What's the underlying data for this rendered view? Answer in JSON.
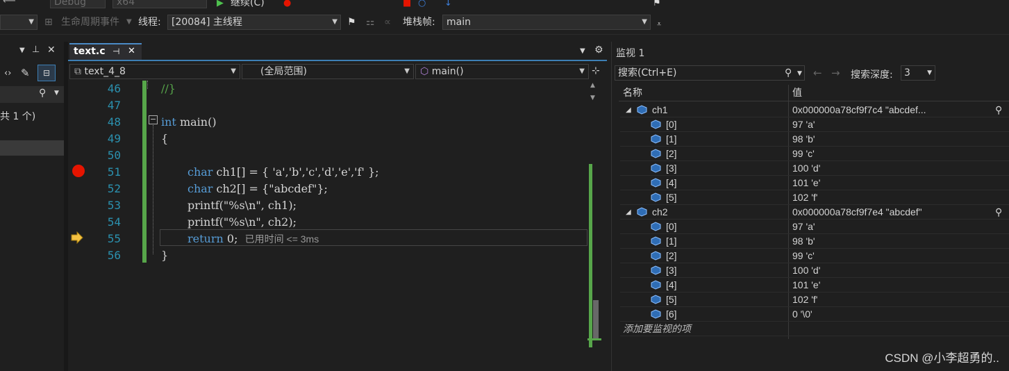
{
  "toolbar": {
    "config": "Debug",
    "platform": "x64",
    "continue_label": "继续(C)",
    "lifecycle_label": "生命周期事件",
    "thread_label": "线程:",
    "thread_value": "[20084] 主线程",
    "stackframe_label": "堆栈帧:",
    "stackframe_value": "main"
  },
  "left_panel": {
    "count_text": "共 1 个)"
  },
  "editor": {
    "tab_label": "text.c",
    "nav_project": "text_4_8",
    "nav_scope": "(全局范围)",
    "nav_function": "main()",
    "lines": [
      {
        "num": "46",
        "text": "//}"
      },
      {
        "num": "47",
        "text": ""
      },
      {
        "num": "48",
        "kw": "int",
        "text": " main()"
      },
      {
        "num": "49",
        "text": "{"
      },
      {
        "num": "50",
        "text": ""
      },
      {
        "num": "51",
        "kw": "char",
        "text": " ch1[] = { 'a','b','c','d','e','f' };"
      },
      {
        "num": "52",
        "kw": "char",
        "text": " ch2[] = {\"abcdef\"};"
      },
      {
        "num": "53",
        "text": "printf(\"%s\\n\", ch1);"
      },
      {
        "num": "54",
        "text": "printf(\"%s\\n\", ch2);"
      },
      {
        "num": "55",
        "kw": "return",
        "text": " 0;"
      },
      {
        "num": "56",
        "text": "}"
      }
    ],
    "elapsed": "已用时间 <= 3ms"
  },
  "watch": {
    "title": "监视 1",
    "search_placeholder": "搜索(Ctrl+E)",
    "depth_label": "搜索深度:",
    "depth_value": "3",
    "col_name": "名称",
    "col_value": "值",
    "rows": [
      {
        "name": "ch1",
        "value": "0x000000a78cf9f7c4 \"abcdef...",
        "level": 0
      },
      {
        "name": "[0]",
        "value": "97 'a'",
        "level": 1
      },
      {
        "name": "[1]",
        "value": "98 'b'",
        "level": 1
      },
      {
        "name": "[2]",
        "value": "99 'c'",
        "level": 1
      },
      {
        "name": "[3]",
        "value": "100 'd'",
        "level": 1
      },
      {
        "name": "[4]",
        "value": "101 'e'",
        "level": 1
      },
      {
        "name": "[5]",
        "value": "102 'f'",
        "level": 1
      },
      {
        "name": "ch2",
        "value": "0x000000a78cf9f7e4 \"abcdef\"",
        "level": 0
      },
      {
        "name": "[0]",
        "value": "97 'a'",
        "level": 1
      },
      {
        "name": "[1]",
        "value": "98 'b'",
        "level": 1
      },
      {
        "name": "[2]",
        "value": "99 'c'",
        "level": 1
      },
      {
        "name": "[3]",
        "value": "100 'd'",
        "level": 1
      },
      {
        "name": "[4]",
        "value": "101 'e'",
        "level": 1
      },
      {
        "name": "[5]",
        "value": "102 'f'",
        "level": 1
      },
      {
        "name": "[6]",
        "value": "0 '\\0'",
        "level": 1
      }
    ],
    "add_item": "添加要监视的项"
  },
  "watermark": "CSDN @小李超勇的.."
}
